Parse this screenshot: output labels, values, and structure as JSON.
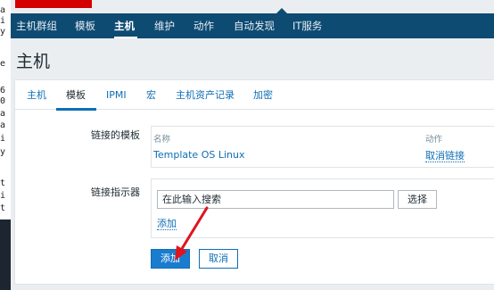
{
  "left_strip": {
    "fragments": [
      "a",
      "i",
      "y",
      "e",
      "6",
      "0",
      "a",
      "a",
      "i",
      "y",
      "t",
      "i",
      "t"
    ]
  },
  "logo": {
    "icon": "zabbix-logo"
  },
  "topnav": {
    "items": [
      "主机群组",
      "模板",
      "主机",
      "维护",
      "动作",
      "自动发现",
      "IT服务"
    ],
    "active": "主机"
  },
  "page_title": "主机",
  "tabs": {
    "items": [
      "主机",
      "模板",
      "IPMI",
      "宏",
      "主机资产记录",
      "加密"
    ],
    "active": "模板"
  },
  "linked_templates": {
    "label": "链接的模板",
    "col_name": "名称",
    "col_action": "动作",
    "rows": [
      {
        "name": "Template OS Linux",
        "action": "取消链接"
      }
    ]
  },
  "link_indicator": {
    "label": "链接指示器",
    "search_value": "在此输入搜索",
    "select_label": "选择",
    "add_link": "添加"
  },
  "buttons": {
    "add": "添加",
    "cancel": "取消"
  },
  "colors": {
    "nav_bg": "#0e4b73",
    "link": "#0f6eb5",
    "primary_button": "#1a7ccf",
    "arrow": "#e0141e",
    "logo": "#d40000"
  }
}
